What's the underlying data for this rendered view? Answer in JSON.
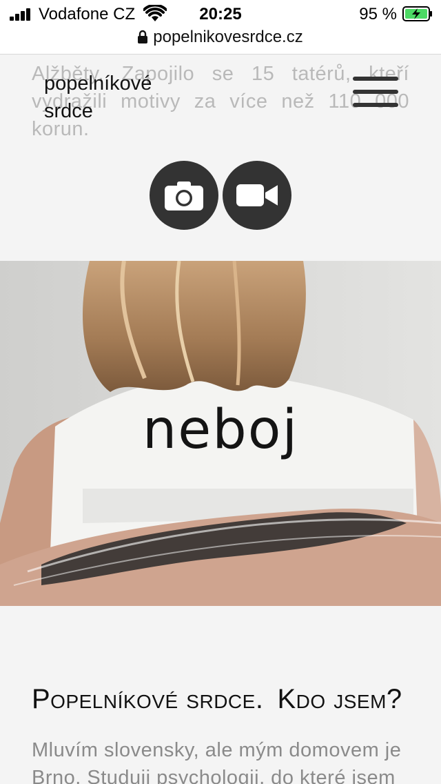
{
  "status_bar": {
    "carrier": "Vodafone CZ",
    "time": "20:25",
    "battery_percent": "95 %",
    "icons": [
      "signal-icon",
      "wifi-icon",
      "battery-charging-icon"
    ]
  },
  "browser": {
    "url": "popelnikovesrdce.cz",
    "icons": [
      "lock-icon"
    ]
  },
  "background_text": "Alžběty. Zapojilo se 15 tatérů, kteří vydražili motivy za více než 110 000 korun.",
  "header": {
    "logo_line1": "popelníkové",
    "logo_line2": "srdce",
    "menu_icon": "hamburger-menu-icon"
  },
  "media_buttons": [
    {
      "icon": "camera-icon"
    },
    {
      "icon": "video-camera-icon"
    }
  ],
  "hero": {
    "shirt_text": "neboj"
  },
  "about": {
    "title_part1": "Popelníkové srdce.",
    "title_part2": "Kdo jsem?",
    "text": "Mluvím slovensky, ale mým domovem je Brno. Studuji psychologii, do které jsem"
  },
  "colors": {
    "page_background": "#f4f4f4",
    "button_background": "#333333",
    "battery_green": "#4cd964"
  }
}
